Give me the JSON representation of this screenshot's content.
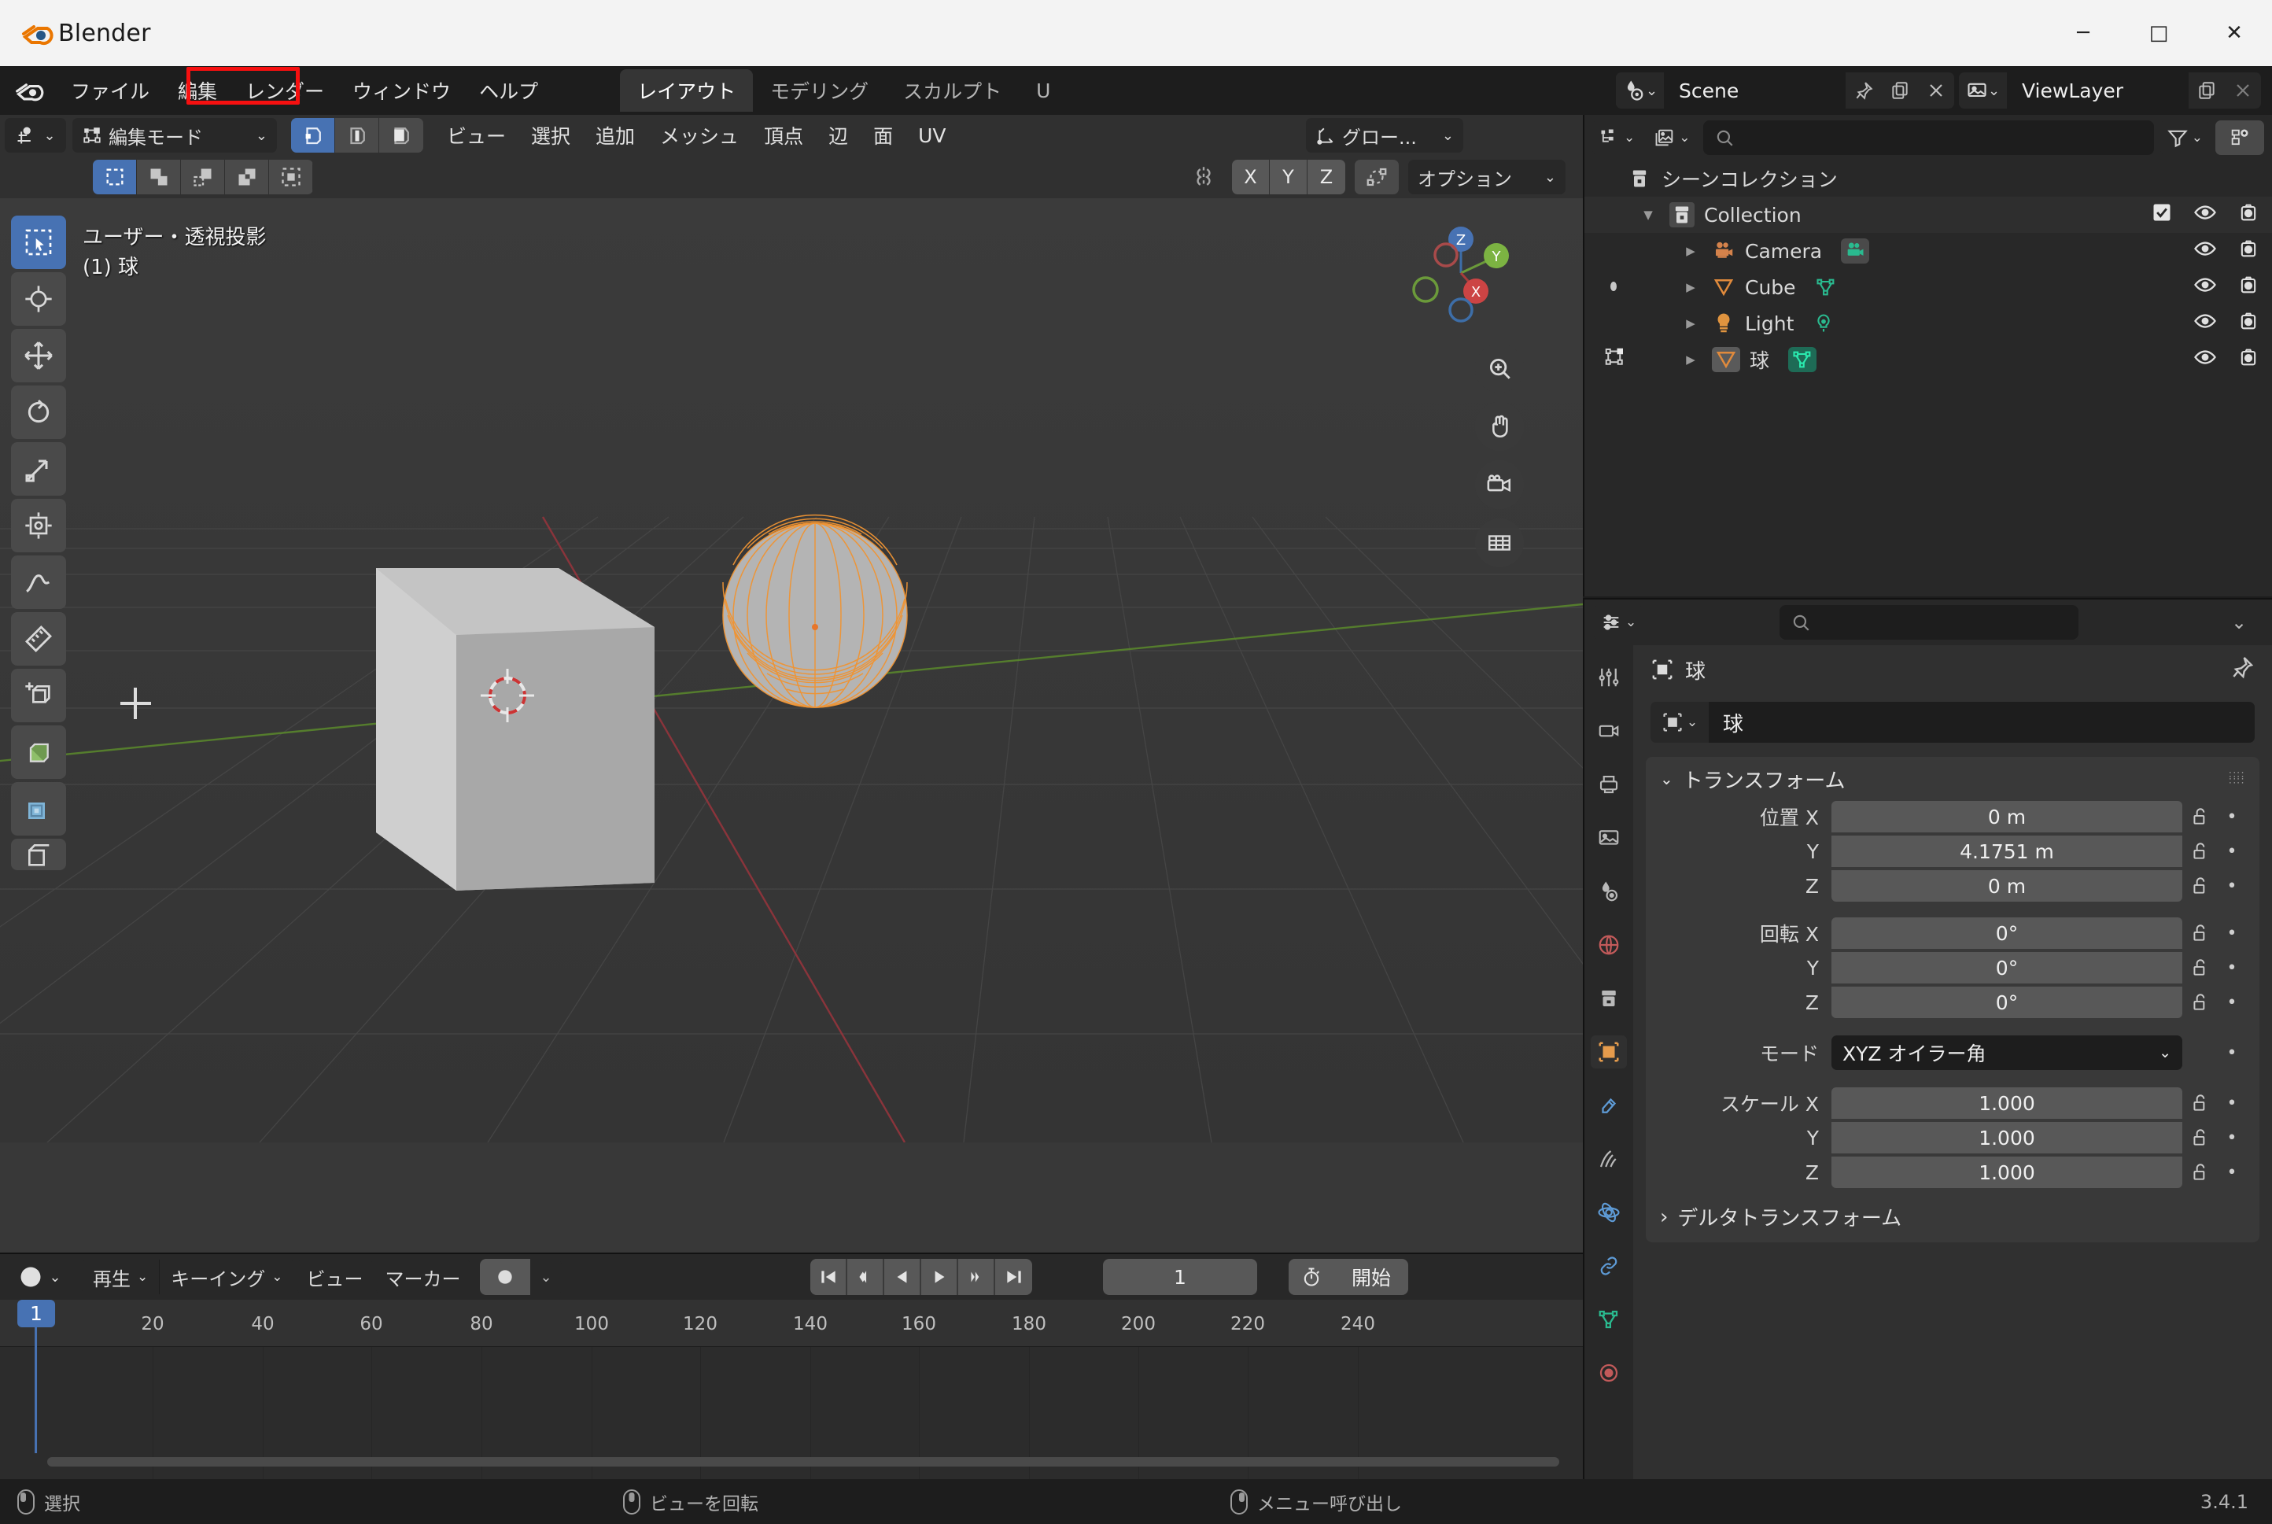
{
  "window": {
    "title": "Blender",
    "minimize": "─",
    "maximize": "□",
    "close": "✕"
  },
  "topbar": {
    "menus": [
      "ファイル",
      "編集",
      "レンダー",
      "ウィンドウ",
      "ヘルプ"
    ],
    "workspace_tabs": [
      {
        "label": "レイアウト",
        "active": true
      },
      {
        "label": "モデリング",
        "active": false
      },
      {
        "label": "スカルプト",
        "active": false
      },
      {
        "label": "U",
        "active": false
      }
    ],
    "scene_name": "Scene",
    "view_layer_name": "ViewLayer",
    "scene_icon": "scene-icon",
    "viewlayer_icon": "viewlayer-icon",
    "pin_icon": "pin-icon",
    "copy_icon": "copy-icon",
    "delete_icon": "x-icon"
  },
  "viewport": {
    "editor_type_icon": "editor-type-icon",
    "mode_label": "編集モード",
    "mesh_select_modes": [
      {
        "name": "vertex-select-mode",
        "active": true
      },
      {
        "name": "edge-select-mode",
        "active": false
      },
      {
        "name": "face-select-mode",
        "active": false
      }
    ],
    "menus": [
      "ビュー",
      "選択",
      "追加",
      "メッシュ",
      "頂点",
      "辺",
      "面",
      "UV"
    ],
    "transform_orientation": "グロー...",
    "select_tool_modes": [
      {
        "name": "select-new",
        "active": true
      },
      {
        "name": "select-extend",
        "active": false
      },
      {
        "name": "select-subtract",
        "active": false
      },
      {
        "name": "select-invert",
        "active": false
      },
      {
        "name": "select-intersect",
        "active": false
      }
    ],
    "mirror_icon": "mirror-x-icon",
    "axes": [
      "X",
      "Y",
      "Z"
    ],
    "proportional_icon": "proportional-editing-icon",
    "options_label": "オプション",
    "overlay_line1": "ユーザー・透視投影",
    "overlay_line2": "(1) 球",
    "gizmo_axes": [
      "Z",
      "Y",
      "X"
    ],
    "nav_buttons": [
      "zoom-icon",
      "pan-icon",
      "camera-icon",
      "ortho-persp-icon"
    ],
    "tools": [
      {
        "name": "tweak-tool",
        "active": true
      },
      {
        "name": "cursor-tool",
        "active": false
      },
      {
        "name": "move-tool",
        "active": false
      },
      {
        "name": "rotate-tool",
        "active": false
      },
      {
        "name": "scale-tool",
        "active": false
      },
      {
        "name": "transform-tool",
        "active": false
      },
      {
        "name": "annotate-tool",
        "active": false
      },
      {
        "name": "measure-tool",
        "active": false
      },
      {
        "name": "add-cube-tool",
        "active": false
      },
      {
        "name": "extrude-tool",
        "active": false
      },
      {
        "name": "inset-faces-tool",
        "active": false
      },
      {
        "name": "bevel-tool",
        "active": false
      }
    ],
    "annotation_box": "mesh-select-mode-highlight"
  },
  "timeline": {
    "editor_icon": "timeline-editor-icon",
    "menus": [
      "再生",
      "キーイング",
      "ビュー",
      "マーカー"
    ],
    "autokey_icon": "record-icon",
    "playback_buttons": [
      "jump-start",
      "prev-keyframe",
      "play-reverse",
      "play",
      "next-keyframe",
      "jump-end"
    ],
    "current_frame": "1",
    "start_icon": "stopwatch-icon",
    "start_label": "開始",
    "ruler_ticks": [
      "20",
      "40",
      "60",
      "80",
      "100",
      "120",
      "140",
      "160",
      "180",
      "200",
      "220",
      "240"
    ],
    "playhead_label": "1"
  },
  "outliner": {
    "display_mode_icon": "outliner-display-icon",
    "filter_blend_icon": "blend-file-icon",
    "search_placeholder": "",
    "filter_icon": "filter-icon",
    "new_collection_icon": "new-collection-icon",
    "root": "シーンコレクション",
    "items": [
      {
        "label": "Collection",
        "icon": "collection-icon",
        "indent": 1,
        "has_checkbox": true,
        "checked": true,
        "expand": "▼",
        "eye": true,
        "camera": true,
        "data_icon": null
      },
      {
        "label": "Camera",
        "icon": "camera-object-icon",
        "indent": 2,
        "has_checkbox": false,
        "expand": "▶",
        "eye": true,
        "camera": true,
        "data_icon": "camera-data-icon"
      },
      {
        "label": "Cube",
        "icon": "mesh-object-icon",
        "indent": 2,
        "has_checkbox": false,
        "expand": "▶",
        "eye": true,
        "camera": true,
        "data_icon": "mesh-data-icon"
      },
      {
        "label": "Light",
        "icon": "light-object-icon",
        "indent": 2,
        "has_checkbox": false,
        "expand": "▶",
        "eye": true,
        "camera": true,
        "data_icon": "light-data-icon"
      },
      {
        "label": "球",
        "icon": "mesh-object-icon",
        "indent": 2,
        "has_checkbox": false,
        "expand": "▶",
        "eye": true,
        "camera": true,
        "data_icon": "mesh-data-icon"
      }
    ]
  },
  "properties": {
    "editor_icon": "properties-editor-icon",
    "search_placeholder": "",
    "expand_icon": "chevron-down-icon",
    "tabs": [
      {
        "name": "tool-tab",
        "active": false
      },
      {
        "name": "render-tab",
        "active": false
      },
      {
        "name": "output-tab",
        "active": false
      },
      {
        "name": "view-layer-tab",
        "active": false
      },
      {
        "name": "scene-tab",
        "active": false
      },
      {
        "name": "world-tab",
        "active": false
      },
      {
        "name": "collection-tab",
        "active": false
      },
      {
        "name": "object-tab",
        "active": true
      },
      {
        "name": "modifier-tab",
        "active": false
      },
      {
        "name": "particles-tab",
        "active": false
      },
      {
        "name": "physics-tab",
        "active": false
      },
      {
        "name": "constraints-tab",
        "active": false
      },
      {
        "name": "data-tab",
        "active": false
      },
      {
        "name": "material-tab",
        "active": false
      }
    ],
    "breadcrumb_object": "球",
    "pin_icon": "pin-icon",
    "object_name": "球",
    "panel_title": "トランスフォーム",
    "grip_icon": "grip-icon",
    "fields": [
      {
        "group": "location",
        "label": "位置 X",
        "value": "0 m",
        "lock": "unlocked",
        "anim": "•"
      },
      {
        "group": "location",
        "label": "Y",
        "value": "4.1751 m",
        "lock": "unlocked",
        "anim": "•"
      },
      {
        "group": "location",
        "label": "Z",
        "value": "0 m",
        "lock": "unlocked",
        "anim": "•"
      },
      {
        "group": "rotation",
        "label": "回転 X",
        "value": "0°",
        "lock": "unlocked",
        "anim": "•"
      },
      {
        "group": "rotation",
        "label": "Y",
        "value": "0°",
        "lock": "unlocked",
        "anim": "•"
      },
      {
        "group": "rotation",
        "label": "Z",
        "value": "0°",
        "lock": "unlocked",
        "anim": "•"
      }
    ],
    "mode_label": "モード",
    "mode_value": "XYZ オイラー角",
    "scale_fields": [
      {
        "label": "スケール X",
        "value": "1.000"
      },
      {
        "label": "Y",
        "value": "1.000"
      },
      {
        "label": "Z",
        "value": "1.000"
      }
    ],
    "delta_panel": "デルタトランスフォーム",
    "delta_expand": "›"
  },
  "status": {
    "items": [
      {
        "mouse": "left",
        "label": "選択"
      },
      {
        "mouse": "middle",
        "label": "ビューを回転"
      },
      {
        "mouse": "right",
        "label": "メニュー呼び出し"
      }
    ],
    "version": "3.4.1"
  },
  "colors": {
    "accent_blue": "#4772b3",
    "selection_orange": "#f09433",
    "annotation_red": "#f61010",
    "bg_dark": "#1d1d1d",
    "bg_editor": "#303030",
    "bg_panel": "#282828"
  }
}
